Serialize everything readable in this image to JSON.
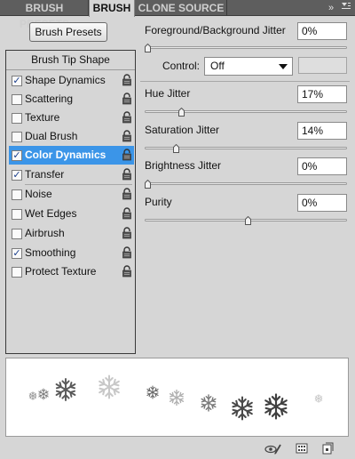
{
  "tabs": [
    {
      "label": "Brush Presets"
    },
    {
      "label": "Brush"
    },
    {
      "label": "Clone Source"
    }
  ],
  "tabbar_icons": {
    "collapse": "collapse-icon",
    "menu": "panel-menu-icon"
  },
  "brush_presets_button": "Brush Presets",
  "list": {
    "header": "Brush Tip Shape",
    "items": [
      {
        "label": "Shape Dynamics",
        "checked": true,
        "selected": false
      },
      {
        "label": "Scattering",
        "checked": false,
        "selected": false
      },
      {
        "label": "Texture",
        "checked": false,
        "selected": false
      },
      {
        "label": "Dual Brush",
        "checked": false,
        "selected": false
      },
      {
        "label": "Color Dynamics",
        "checked": true,
        "selected": true
      },
      {
        "label": "Transfer",
        "checked": true,
        "selected": false
      },
      {
        "label": "Noise",
        "checked": false,
        "selected": false
      },
      {
        "label": "Wet Edges",
        "checked": false,
        "selected": false
      },
      {
        "label": "Airbrush",
        "checked": false,
        "selected": false
      },
      {
        "label": "Smoothing",
        "checked": true,
        "selected": false
      },
      {
        "label": "Protect Texture",
        "checked": false,
        "selected": false
      }
    ]
  },
  "settings": {
    "fg_bg_jitter": {
      "label": "Foreground/Background Jitter",
      "value": "0%",
      "slider": 0
    },
    "control": {
      "label": "Control:",
      "value": "Off"
    },
    "hue_jitter": {
      "label": "Hue Jitter",
      "value": "17%",
      "slider": 0.17
    },
    "saturation_jitter": {
      "label": "Saturation Jitter",
      "value": "14%",
      "slider": 0.14
    },
    "brightness_jitter": {
      "label": "Brightness Jitter",
      "value": "0%",
      "slider": 0
    },
    "purity": {
      "label": "Purity",
      "value": "0%",
      "slider": 0.5
    }
  },
  "bottom_icons": [
    "toggle-live-tip-preview-icon",
    "create-new-preset-icon",
    "new-brush-icon"
  ]
}
